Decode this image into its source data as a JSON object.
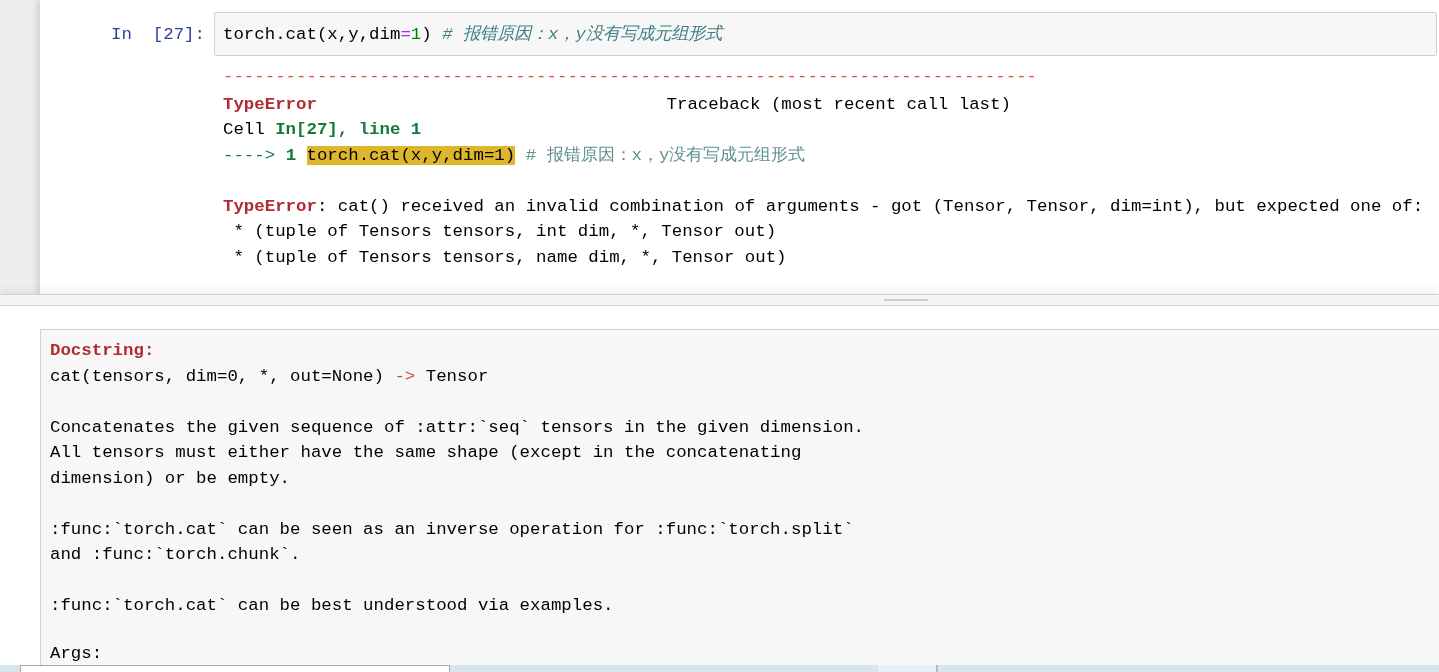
{
  "cell": {
    "prompt": "In  [27]:",
    "code": [
      {
        "kind": "plain",
        "text": "torch.cat(x,y,dim"
      },
      {
        "kind": "operator",
        "text": "="
      },
      {
        "kind": "number",
        "text": "1"
      },
      {
        "kind": "plain",
        "text": ") "
      },
      {
        "kind": "comment",
        "text": "# 报错原因：x，y没有写成元组形式"
      }
    ]
  },
  "traceback": {
    "separator": "------------------------------------------------------------------------------",
    "error_type": "TypeError",
    "heading": "Traceback (most recent call last)",
    "location": [
      {
        "kind": "plain",
        "text": "Cell "
      },
      {
        "kind": "location",
        "text": "In[27], line 1"
      }
    ],
    "source_line": [
      {
        "kind": "arrow",
        "text": "----> "
      },
      {
        "kind": "line_number",
        "text": "1 "
      },
      {
        "kind": "highlight",
        "text": "torch.cat(x,y,dim=1)"
      },
      {
        "kind": "comment",
        "text": " # 报错原因：x，y没有写成元组形式"
      }
    ],
    "message": [
      {
        "kind": "error_type",
        "text": "TypeError"
      },
      {
        "kind": "plain",
        "text": ": cat() received an invalid combination of arguments - got (Tensor, Tensor, dim=int), but expected one of:"
      }
    ],
    "signatures": [
      " * (tuple of Tensors tensors, int dim, *, Tensor out)",
      " * (tuple of Tensors tensors, name dim, *, Tensor out)"
    ]
  },
  "docstring": {
    "heading": "Docstring:",
    "signature": [
      {
        "kind": "plain",
        "text": "cat(tensors, dim=0, *, out=None) "
      },
      {
        "kind": "operator",
        "text": "->"
      },
      {
        "kind": "plain",
        "text": " Tensor"
      }
    ],
    "paragraphs": [
      "Concatenates the given sequence of :attr:`seq` tensors in the given dimension.\nAll tensors must either have the same shape (except in the concatenating\ndimension) or be empty.",
      ":func:`torch.cat` can be seen as an inverse operation for :func:`torch.split`\nand :func:`torch.chunk`.",
      ":func:`torch.cat` can be best understood via examples.",
      "Args:"
    ]
  }
}
